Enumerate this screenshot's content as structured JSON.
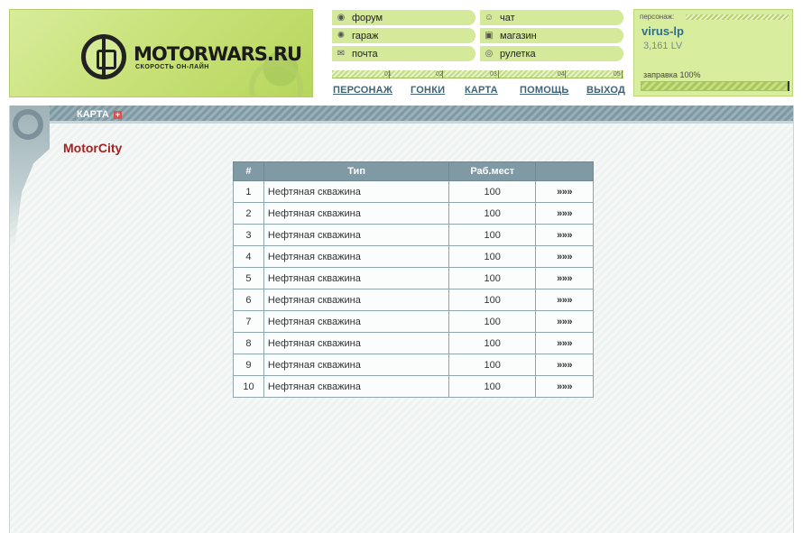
{
  "logo": {
    "title": "MOTORWARS.RU",
    "subtitle": "СКОРОСТЬ ОН-ЛАЙН"
  },
  "quick_nav": [
    {
      "label": "форум",
      "icon": "forum-icon"
    },
    {
      "label": "чат",
      "icon": "chat-icon"
    },
    {
      "label": "гараж",
      "icon": "wrench-icon"
    },
    {
      "label": "магазин",
      "icon": "car-icon"
    },
    {
      "label": "почта",
      "icon": "mail-icon"
    },
    {
      "label": "рулетка",
      "icon": "roulette-icon"
    }
  ],
  "ruler_ticks": [
    "01",
    "02",
    "03",
    "04",
    "05"
  ],
  "main_nav": [
    "ПЕРСОНАЖ",
    "ГОНКИ",
    "КАРТА",
    "ПОМОЩЬ",
    "ВЫХОД"
  ],
  "character": {
    "label": "персонаж:",
    "name": "virus-lp",
    "lv": "3,161 LV",
    "fuel_label": "заправка 100%",
    "fuel_fraction": 1.0
  },
  "section": {
    "title": "КАРТА",
    "city": "MotorCity"
  },
  "table": {
    "headers": [
      "#",
      "Тип",
      "Раб.мест",
      ""
    ],
    "rows": [
      {
        "num": "1",
        "type": "Нефтяная скважина",
        "workers": "100",
        "link": "»»»"
      },
      {
        "num": "2",
        "type": "Нефтяная скважина",
        "workers": "100",
        "link": "»»»"
      },
      {
        "num": "3",
        "type": "Нефтяная скважина",
        "workers": "100",
        "link": "»»»"
      },
      {
        "num": "4",
        "type": "Нефтяная скважина",
        "workers": "100",
        "link": "»»»"
      },
      {
        "num": "5",
        "type": "Нефтяная скважина",
        "workers": "100",
        "link": "»»»"
      },
      {
        "num": "6",
        "type": "Нефтяная скважина",
        "workers": "100",
        "link": "»»»"
      },
      {
        "num": "7",
        "type": "Нефтяная скважина",
        "workers": "100",
        "link": "»»»"
      },
      {
        "num": "8",
        "type": "Нефтяная скважина",
        "workers": "100",
        "link": "»»»"
      },
      {
        "num": "9",
        "type": "Нефтяная скважина",
        "workers": "100",
        "link": "»»»"
      },
      {
        "num": "10",
        "type": "Нефтяная скважина",
        "workers": "100",
        "link": "»»»"
      }
    ]
  },
  "colors": {
    "header_green": "#d4e99a",
    "link_blue": "#3f6478",
    "table_header": "#7f9aa4",
    "city_red": "#a12424"
  }
}
